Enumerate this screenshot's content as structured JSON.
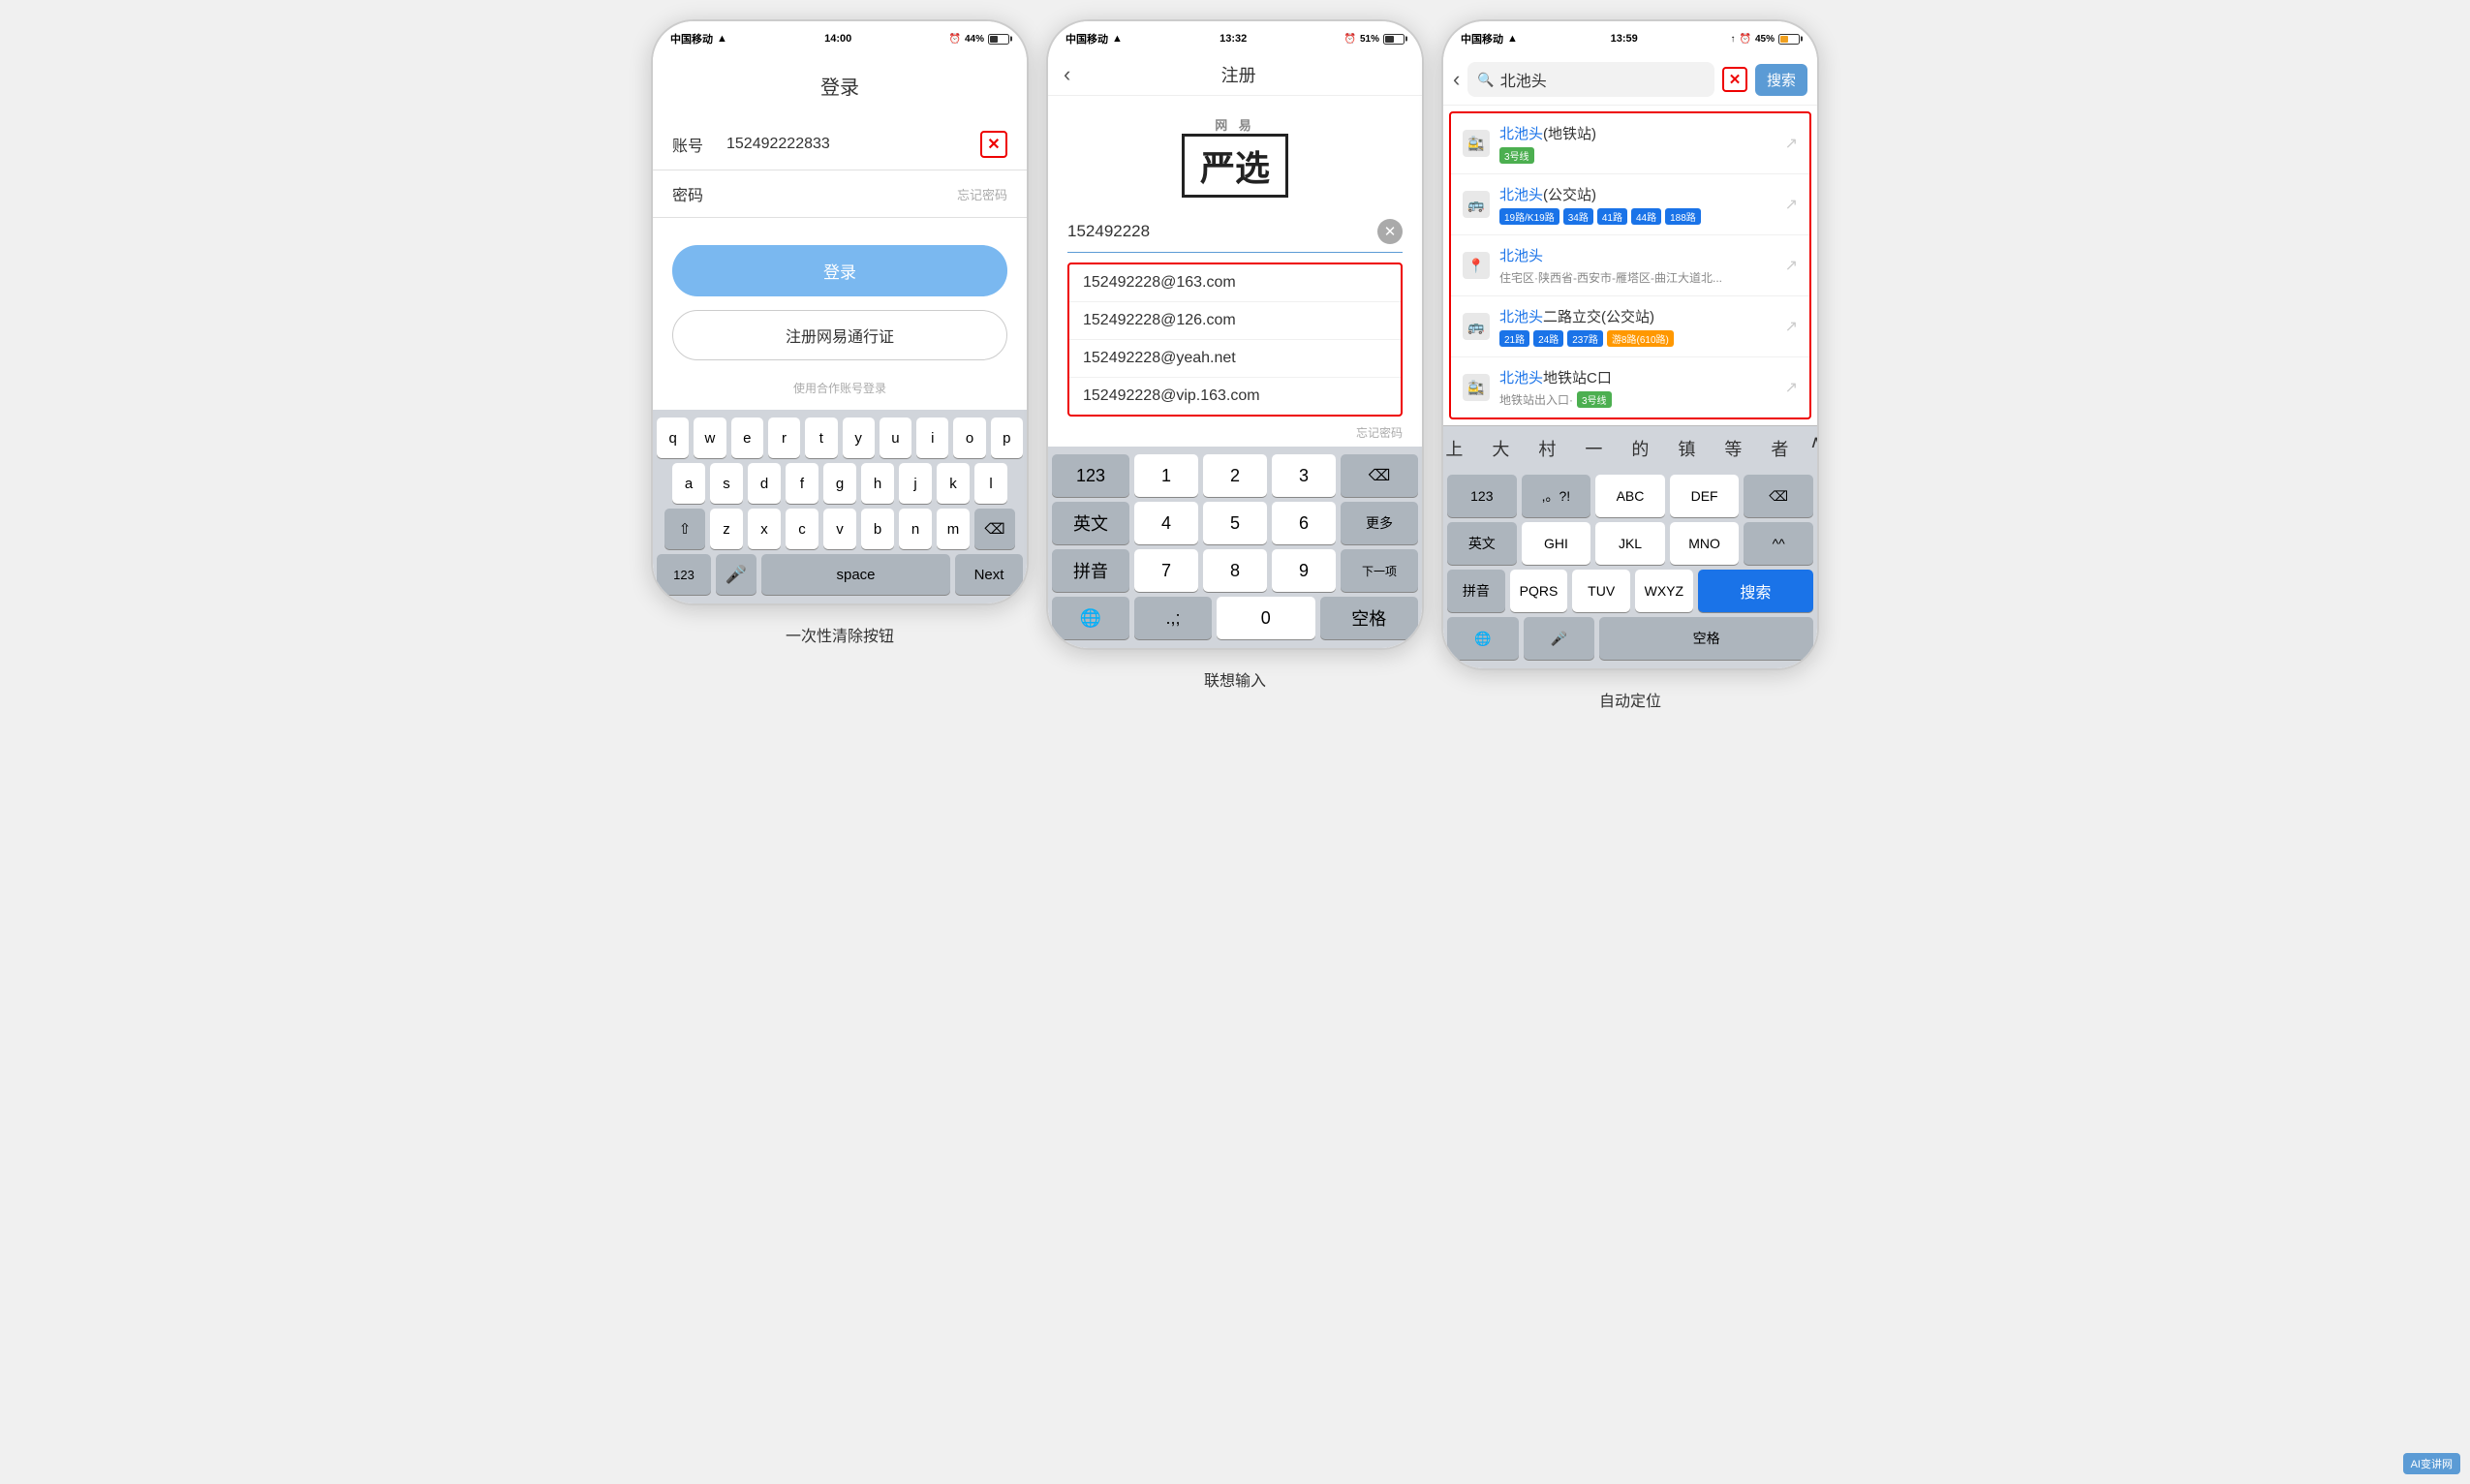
{
  "phone1": {
    "status": {
      "carrier": "中国移动",
      "wifi": "WiFi",
      "time": "14:00",
      "battery_label": "44%",
      "battery_pct": 44
    },
    "title": "登录",
    "fields": {
      "account_label": "账号",
      "account_value": "152492222833",
      "password_label": "密码",
      "forget_pwd": "忘记密码"
    },
    "login_btn": "登录",
    "register_btn": "注册网易通行证",
    "partner_text": "使用合作账号登录",
    "keyboard": {
      "rows": [
        [
          "q",
          "w",
          "e",
          "r",
          "t",
          "y",
          "u",
          "i",
          "o",
          "p"
        ],
        [
          "a",
          "s",
          "d",
          "f",
          "g",
          "h",
          "j",
          "k",
          "l"
        ],
        [
          "⇧",
          "z",
          "x",
          "c",
          "v",
          "b",
          "n",
          "m",
          "⌫"
        ],
        [
          "123",
          "🎤",
          "space",
          "Next"
        ]
      ]
    }
  },
  "phone2": {
    "status": {
      "carrier": "中国移动",
      "wifi": "WiFi",
      "time": "13:32",
      "battery_label": "51%",
      "battery_pct": 51
    },
    "back": "‹",
    "title": "注册",
    "brand": "严选",
    "brand_top": "网 易",
    "input_value": "152492228",
    "suggestions": [
      "152492228@163.com",
      "152492228@126.com",
      "152492228@yeah.net",
      "152492228@vip.163.com"
    ],
    "forget_hint": "忘记密码",
    "keyboard": {
      "row1": [
        "123",
        "英文",
        "拼音",
        "🌐"
      ],
      "num_keys": [
        "1",
        "2",
        "3",
        "4",
        "5",
        "6",
        "7",
        "8",
        "9",
        "0"
      ],
      "special": [
        ".,;",
        "空格"
      ],
      "action_del": "⌫",
      "action_next": "下一项"
    }
  },
  "phone3": {
    "status": {
      "carrier": "中国移动",
      "wifi": "WiFi",
      "time": "13:59",
      "battery_label": "45%",
      "battery_pct": 45
    },
    "back": "‹",
    "search_text": "北池头",
    "search_btn": "搜索",
    "results": [
      {
        "icon": "🚉",
        "name_pre": "北池头",
        "name_suf": "(地铁站)",
        "tags": [
          "3号线"
        ],
        "tag_colors": [
          "green"
        ],
        "sub": ""
      },
      {
        "icon": "🚌",
        "name_pre": "北池头",
        "name_suf": "(公交站)",
        "tags": [
          "19路/K19路",
          "34路",
          "41路",
          "44路",
          "188路"
        ],
        "tag_colors": [
          "blue",
          "blue",
          "blue",
          "blue",
          "blue"
        ],
        "sub": ""
      },
      {
        "icon": "📍",
        "name_pre": "北池头",
        "name_suf": "",
        "tags": [],
        "sub": "住宅区·陕西省-西安市-雁塔区-曲江大道北..."
      },
      {
        "icon": "🚌",
        "name_pre": "北池头",
        "name_suf": "二路立交(公交站)",
        "tags": [
          "21路",
          "24路",
          "237路",
          "游8路(610路)"
        ],
        "tag_colors": [
          "blue",
          "blue",
          "blue",
          "orange"
        ],
        "sub": ""
      },
      {
        "icon": "🚉",
        "name_pre": "北池头",
        "name_suf": "地铁站C口",
        "tags": [
          "3号线"
        ],
        "tag_colors": [
          "green"
        ],
        "sub": "地铁站出入口"
      }
    ],
    "ime_chars": [
      "上",
      "大",
      "村",
      "一",
      "的",
      "镇",
      "等",
      "者",
      "^"
    ],
    "keyboard": {
      "row1_fn": [
        "123",
        ",。?!",
        "ABC",
        "DEF",
        "⌫"
      ],
      "row2_fn": [
        "英文",
        "GHI",
        "JKL",
        "MNO",
        "^^"
      ],
      "row3_fn": [
        "拼音",
        "PQRS",
        "TUV",
        "WXYZ"
      ],
      "row4": [
        "🌐",
        "🎤",
        "空格",
        "搜索"
      ]
    }
  },
  "captions": {
    "phone1": "一次性清除按钮",
    "phone2": "联想输入",
    "phone3": "自动定位"
  }
}
